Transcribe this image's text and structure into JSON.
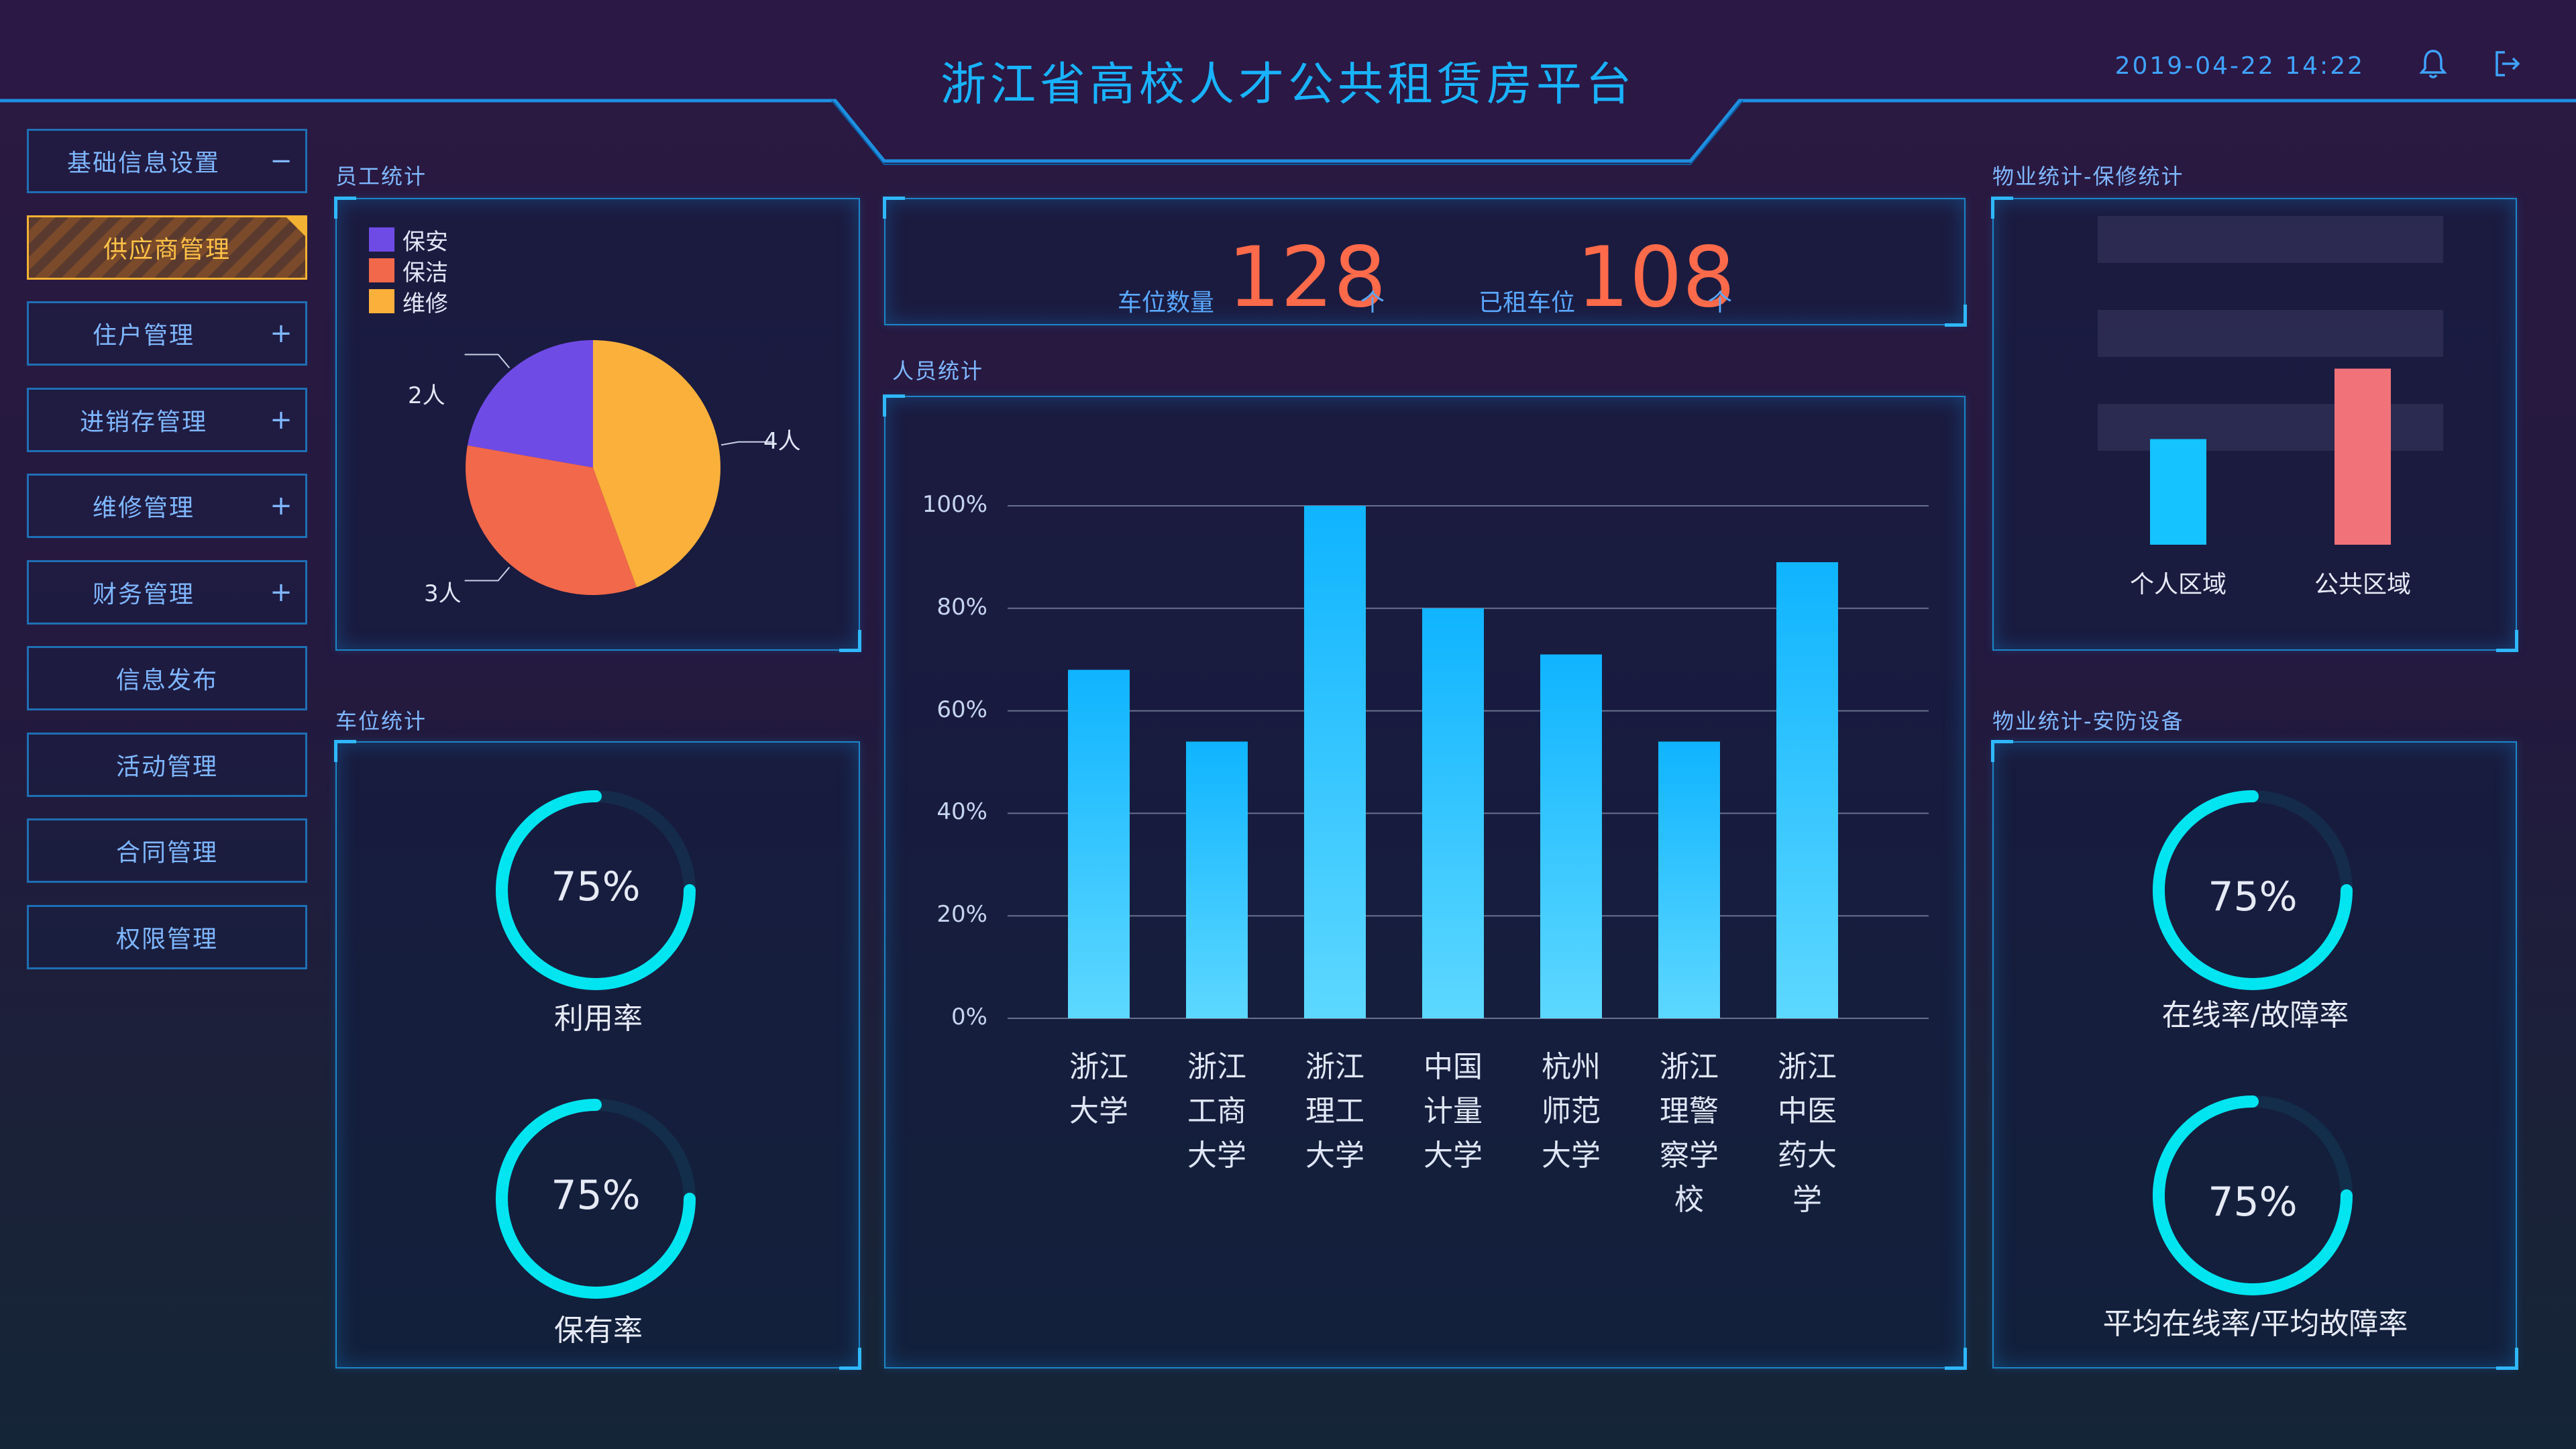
{
  "header": {
    "title": "浙江省高校人才公共租赁房平台",
    "datetime": "2019-04-22 14:22",
    "bell_icon": "bell-icon",
    "logout_icon": "logout-icon"
  },
  "sidebar": {
    "items": [
      {
        "label": "基础信息设置",
        "toggle": "−",
        "active": false
      },
      {
        "label": "供应商管理",
        "toggle": "",
        "active": true
      },
      {
        "label": "住户管理",
        "toggle": "+",
        "active": false
      },
      {
        "label": "进销存管理",
        "toggle": "+",
        "active": false
      },
      {
        "label": "维修管理",
        "toggle": "+",
        "active": false
      },
      {
        "label": "财务管理",
        "toggle": "+",
        "active": false
      },
      {
        "label": "信息发布",
        "toggle": "",
        "active": false
      },
      {
        "label": "活动管理",
        "toggle": "",
        "active": false
      },
      {
        "label": "合同管理",
        "toggle": "",
        "active": false
      },
      {
        "label": "权限管理",
        "toggle": "",
        "active": false
      }
    ]
  },
  "employee_stats": {
    "title": "员工统计",
    "legend": [
      {
        "name": "保安",
        "color": "#6f4be6"
      },
      {
        "name": "保洁",
        "color": "#f2684a"
      },
      {
        "name": "维修",
        "color": "#fbb03b"
      }
    ],
    "slice_labels": [
      "2人",
      "3人",
      "4人"
    ]
  },
  "parking_stats": {
    "title": "车位统计",
    "gauges": [
      {
        "value_text": "75%",
        "value": 0.75,
        "label": "利用率"
      },
      {
        "value_text": "75%",
        "value": 0.75,
        "label": "保有率"
      }
    ]
  },
  "parking_summary": {
    "spaces_label": "车位数量",
    "spaces_value": "128",
    "spaces_unit": "个",
    "rented_label": "已租车位",
    "rented_value": "108",
    "rented_unit": "个"
  },
  "people_stats": {
    "title": "人员统计"
  },
  "repair_stats": {
    "title": "物业统计-保修统计"
  },
  "security_stats": {
    "title": "物业统计-安防设备",
    "gauges": [
      {
        "value_text": "75%",
        "value": 0.75,
        "label": "在线率/故障率"
      },
      {
        "value_text": "75%",
        "value": 0.75,
        "label": "平均在线率/平均故障率"
      }
    ]
  },
  "colors": {
    "accent": "#19b2ff",
    "gauge": "#00e5f0",
    "bar_top": "#0fb4ff",
    "bar_bottom": "#5dd8ff",
    "highlight": "#ff6a4b",
    "active_menu": "#f3b233"
  },
  "chart_data": [
    {
      "type": "pie",
      "categories": [
        "保安",
        "保洁",
        "维修"
      ],
      "values": [
        2,
        3,
        4
      ],
      "labels": [
        "2人",
        "3人",
        "4人"
      ]
    },
    {
      "type": "bar",
      "categories": [
        "浙江大学",
        "浙江工商大学",
        "浙江理工大学",
        "中国计量大学",
        "杭州师范大学",
        "浙江理警察学校",
        "浙江中医药大学"
      ],
      "category_lines": [
        [
          "浙江",
          "大学"
        ],
        [
          "浙江",
          "工商",
          "大学"
        ],
        [
          "浙江",
          "理工",
          "大学"
        ],
        [
          "中国",
          "计量",
          "大学"
        ],
        [
          "杭州",
          "师范",
          "大学"
        ],
        [
          "浙江",
          "理警",
          "察学",
          "校"
        ],
        [
          "浙江",
          "中医",
          "药大",
          "学"
        ]
      ],
      "values": [
        68,
        54,
        100,
        80,
        71,
        54,
        89
      ],
      "ylim": [
        0,
        100
      ],
      "yticks": [
        "0%",
        "20%",
        "40%",
        "60%",
        "80%",
        "100%"
      ],
      "grid": true
    },
    {
      "type": "bar",
      "categories": [
        "个人区域",
        "公共区域"
      ],
      "values": [
        45,
        75
      ],
      "ylim": [
        0,
        100
      ],
      "colors": [
        "#14c3ff",
        "#f2727a"
      ]
    }
  ]
}
